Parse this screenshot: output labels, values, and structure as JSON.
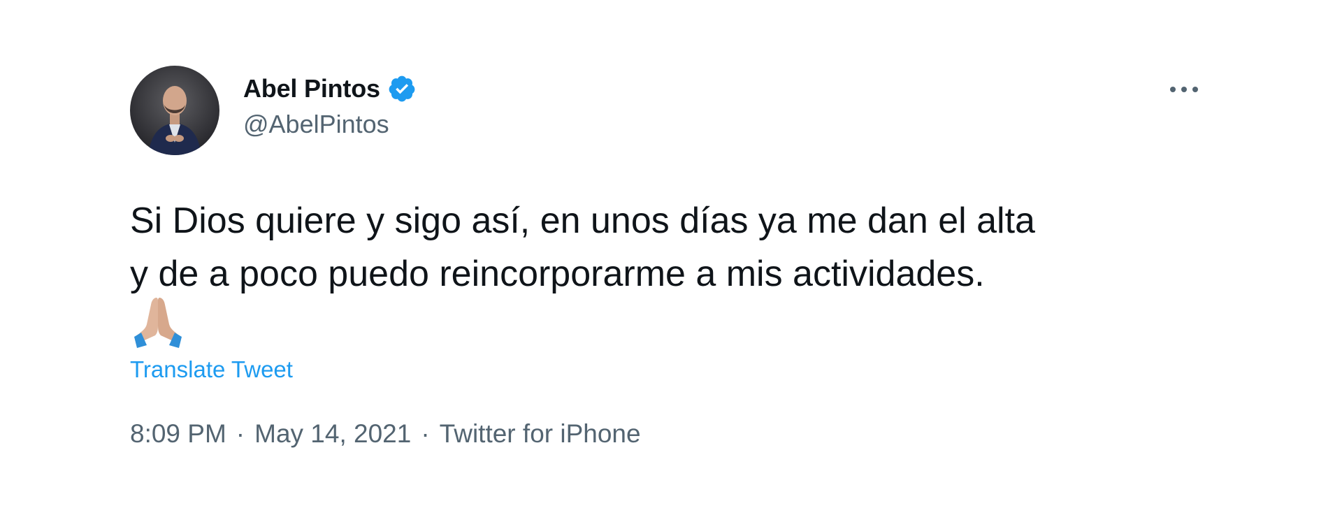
{
  "author": {
    "display_name": "Abel Pintos",
    "handle": "@AbelPintos",
    "verified": true
  },
  "tweet": {
    "text_line1": "Si Dios quiere y sigo así, en unos días ya me dan el alta",
    "text_line2": "y de a poco puedo reincorporarme a mis actividades.",
    "emoji": "folded-hands-icon",
    "translate_label": "Translate Tweet",
    "time": "8:09 PM",
    "date": "May 14, 2021",
    "source": "Twitter for iPhone",
    "separator": "·"
  },
  "colors": {
    "text_primary": "#0f1419",
    "text_secondary": "#536471",
    "accent": "#1d9bf0"
  }
}
